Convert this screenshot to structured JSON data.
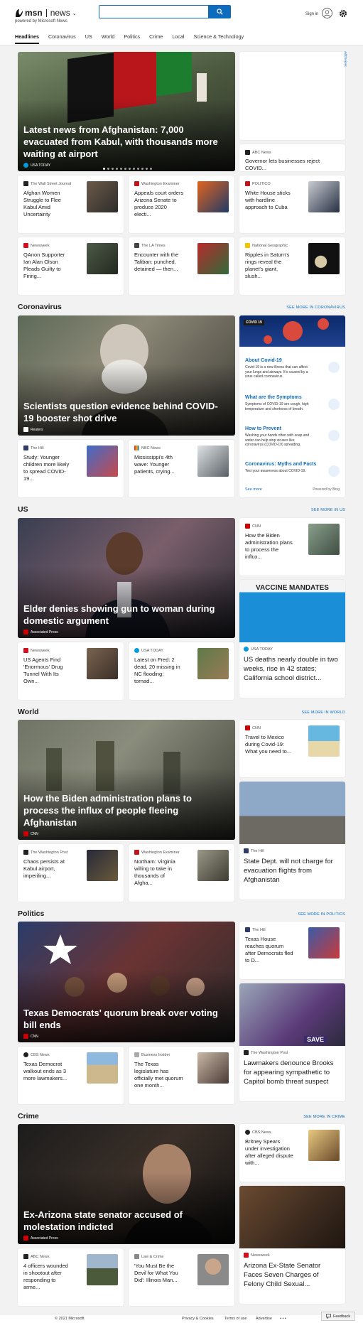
{
  "header": {
    "brand": "msn",
    "section": "news",
    "powered": "powered by Microsoft News",
    "search_value": "",
    "signin": "Sign in"
  },
  "nav": [
    "Headlines",
    "Coronavirus",
    "US",
    "World",
    "Politics",
    "Crime",
    "Local",
    "Science & Technology"
  ],
  "ad": {
    "adchoices": "AdChoices"
  },
  "top": {
    "hero": {
      "title": "Latest news from Afghanistan: 7,000 evacuated from Kabul, with thousands more waiting at airport",
      "source": "USA TODAY"
    },
    "side_small": {
      "source": "ABC News",
      "title": "Governor lets businesses reject COVID..."
    },
    "row1": [
      {
        "source": "The Wall Street Journal",
        "title": "Afghan Women Struggle to Flee Kabul Amid Uncertainty"
      },
      {
        "source": "Washington Examiner",
        "title": "Appeals court orders Arizona Senate to produce 2020 electi..."
      },
      {
        "source": "POLITICO",
        "title": "White House sticks with hardline approach to Cuba"
      }
    ],
    "row2": [
      {
        "source": "Newsweek",
        "title": "QAnon Supporter Ian Alan Olson Pleads Guilty to Firing..."
      },
      {
        "source": "The LA Times",
        "title": "Encounter with the Taliban: punched, detained — then..."
      },
      {
        "source": "National Geographic",
        "title": "Ripples in Saturn's rings reveal the planet's giant, slush..."
      }
    ]
  },
  "coronavirus": {
    "heading": "Coronavirus",
    "see_more": "SEE MORE IN CORONAVIRUS",
    "hero": {
      "title": "Scientists question evidence behind COVID-19 booster shot drive",
      "source": "Reuters"
    },
    "row": [
      {
        "source": "The Hill",
        "title": "Study: Younger children more likely to spread COVID-19..."
      },
      {
        "source": "NBC News",
        "title": "Mississippi's 4th wave: Younger patients, crying..."
      }
    ],
    "widget": {
      "tag": "COVID 19",
      "items": [
        {
          "title": "About Covid-19",
          "desc": "Covid-19 is a new illness that can affect your lungs and airways. It's caused by a virus called coronavirus."
        },
        {
          "title": "What are the Symptoms",
          "desc": "Symptoms of COVID-19 are cough, high temperature and shortness of breath."
        },
        {
          "title": "How to Prevent",
          "desc": "Washing your hands often with soap and water can help stop viruses like coronavirus (COVID-19) spreading."
        },
        {
          "title": "Coronavirus: Myths and Facts",
          "desc": "Test your awareness about COVID-19."
        }
      ],
      "see_more": "See more",
      "powered": "Powered by Bing"
    }
  },
  "us": {
    "heading": "US",
    "see_more": "SEE MORE IN US",
    "hero": {
      "title": "Elder denies showing gun to woman during domestic argument",
      "source": "Associated Press"
    },
    "side_small": {
      "source": "CNN",
      "title": "How the Biden administration plans to process the influx..."
    },
    "side_big": {
      "img_text": "VACCINE MANDATES",
      "source": "USA TODAY",
      "title": "US deaths nearly double in two weeks, rise in 42 states; California school district..."
    },
    "row": [
      {
        "source": "Newsweek",
        "title": "US Agents Find 'Enormous' Drug Tunnel With Its Own..."
      },
      {
        "source": "USA TODAY",
        "title": "Latest on Fred: 2 dead, 20 missing in NC flooding; tornad..."
      }
    ]
  },
  "world": {
    "heading": "World",
    "see_more": "SEE MORE IN WORLD",
    "hero": {
      "title": "How the Biden administration plans to process the influx of people fleeing Afghanistan",
      "source": "CNN"
    },
    "side_small": {
      "source": "CNN",
      "title": "Travel to Mexico during Covid-19: What you need to..."
    },
    "side_big": {
      "source": "The Hill",
      "title": "State Dept. will not charge for evacuation flights from Afghanistan"
    },
    "row": [
      {
        "source": "The Washington Post",
        "title": "Chaos persists at Kabul airport, imperiling..."
      },
      {
        "source": "Washington Examiner",
        "title": "Northam: Virginia willing to take in thousands of Afgha..."
      }
    ]
  },
  "politics": {
    "heading": "Politics",
    "see_more": "SEE MORE IN POLITICS",
    "hero": {
      "title": "Texas Democrats' quorum break over voting bill ends",
      "source": "CNN"
    },
    "side_small": {
      "source": "The Hill",
      "title": "Texas House reaches quorum after Democrats fled to D..."
    },
    "side_big": {
      "img_text": "SAVE",
      "source": "The Washington Post",
      "title": "Lawmakers denounce Brooks for appearing sympathetic to Capitol bomb threat suspect"
    },
    "row": [
      {
        "source": "CBS News",
        "title": "Texas Democrat walkout ends as 3 more lawmakers..."
      },
      {
        "source": "Business Insider",
        "title": "The Texas legislature has officially met quorum one month..."
      }
    ]
  },
  "crime": {
    "heading": "Crime",
    "see_more": "SEE MORE IN CRIME",
    "hero": {
      "title": "Ex-Arizona state senator accused of molestation indicted",
      "source": "Associated Press"
    },
    "side_small": {
      "source": "CBS News",
      "title": "Britney Spears under investigation after alleged dispute with..."
    },
    "side_big": {
      "source": "Newsweek",
      "title": "Arizona Ex-State Senator Faces Seven Charges of Felony Child Sexual..."
    },
    "row": [
      {
        "source": "ABC News",
        "title": "4 officers wounded in shootout after responding to arme..."
      },
      {
        "source": "Law & Crime",
        "title": "'You Must Be the Devil for What You Did': Illinois Man..."
      }
    ]
  },
  "footer": {
    "copyright": "© 2021 Microsoft",
    "privacy": "Privacy & Cookies",
    "terms": "Terms of use",
    "advertise": "Advertise",
    "more": "• • •",
    "feedback": "Feedback"
  }
}
